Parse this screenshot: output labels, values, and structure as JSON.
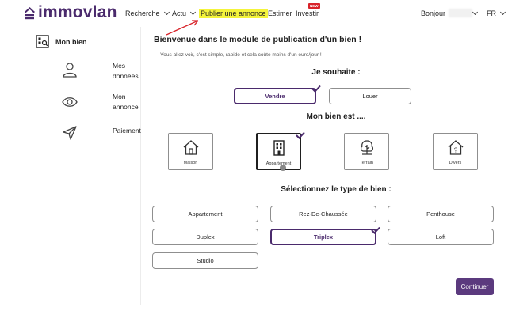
{
  "brand": {
    "name": "immovlan",
    "color": "#4a2a6c"
  },
  "nav": {
    "items": [
      {
        "label": "Recherche",
        "dropdown": true
      },
      {
        "label": "Actu",
        "dropdown": true
      },
      {
        "label": "Publier une annonce",
        "highlight": "#f4f43b"
      },
      {
        "label": "Estimer"
      },
      {
        "label": "Investir",
        "badge": "NEW"
      }
    ],
    "greeting": "Bonjour",
    "language": "FR"
  },
  "sidebar": {
    "title": "Mon bien",
    "items": [
      {
        "label": "Mes données",
        "icon": "user-icon"
      },
      {
        "label": "Mon annonce",
        "icon": "eye-icon"
      },
      {
        "label": "Paiement",
        "icon": "send-icon"
      }
    ]
  },
  "main": {
    "welcome": "Bienvenue dans le module de publication d'un bien !",
    "subtitle": "— Vous allez voir, c'est simple, rapide et cela coûte moins d'un euro/jour !",
    "wish": {
      "title": "Je souhaite :",
      "options": [
        "Vendre",
        "Louer"
      ],
      "selected": "Vendre"
    },
    "property": {
      "title": "Mon bien est ....",
      "options": [
        {
          "label": "Maison",
          "icon": "house-icon"
        },
        {
          "label": "Appartement",
          "icon": "building-icon"
        },
        {
          "label": "Terrain",
          "icon": "tree-icon"
        },
        {
          "label": "Divers",
          "icon": "question-house-icon"
        }
      ],
      "selected": "Appartement"
    },
    "type": {
      "title": "Sélectionnez le type de bien :",
      "options": [
        "Appartement",
        "Rez-De-Chaussée",
        "Penthouse",
        "Duplex",
        "Triplex",
        "Loft",
        "Studio"
      ],
      "selected": "Triplex"
    },
    "continue_label": "Continuer"
  },
  "colors": {
    "accent": "#5b3a7e",
    "text": "#1f1f1f",
    "highlight": "#f4f43b",
    "arrow": "#d8232a"
  }
}
